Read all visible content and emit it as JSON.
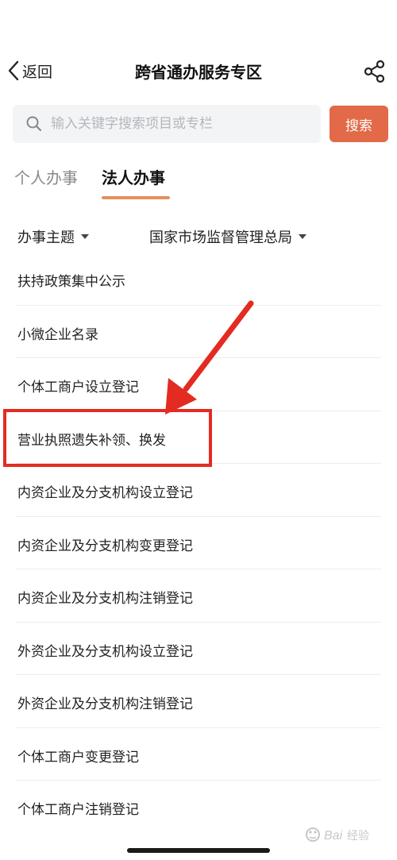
{
  "nav": {
    "back_label": "返回",
    "title": "跨省通办服务专区"
  },
  "search": {
    "placeholder": "输入关键字搜索项目或专栏",
    "button_label": "搜索"
  },
  "tabs": [
    {
      "label": "个人办事",
      "active": false
    },
    {
      "label": "法人办事",
      "active": true
    }
  ],
  "filters": {
    "theme_label": "办事主题",
    "department_label": "国家市场监督管理总局"
  },
  "items": [
    {
      "label": "扶持政策集中公示"
    },
    {
      "label": "小微企业名录"
    },
    {
      "label": "个体工商户设立登记"
    },
    {
      "label": "营业执照遗失补领、换发",
      "highlighted": true
    },
    {
      "label": "内资企业及分支机构设立登记"
    },
    {
      "label": "内资企业及分支机构变更登记"
    },
    {
      "label": "内资企业及分支机构注销登记"
    },
    {
      "label": "外资企业及分支机构设立登记"
    },
    {
      "label": "外资企业及分支机构注销登记"
    },
    {
      "label": "个体工商户变更登记"
    },
    {
      "label": "个体工商户注销登记"
    }
  ],
  "colors": {
    "accent": "#e26a48",
    "tab_underline": "#e6905e",
    "annotation_red": "#e32b22"
  },
  "icons": {
    "back": "chevron-left-icon",
    "share": "share-icon",
    "search": "search-icon"
  }
}
